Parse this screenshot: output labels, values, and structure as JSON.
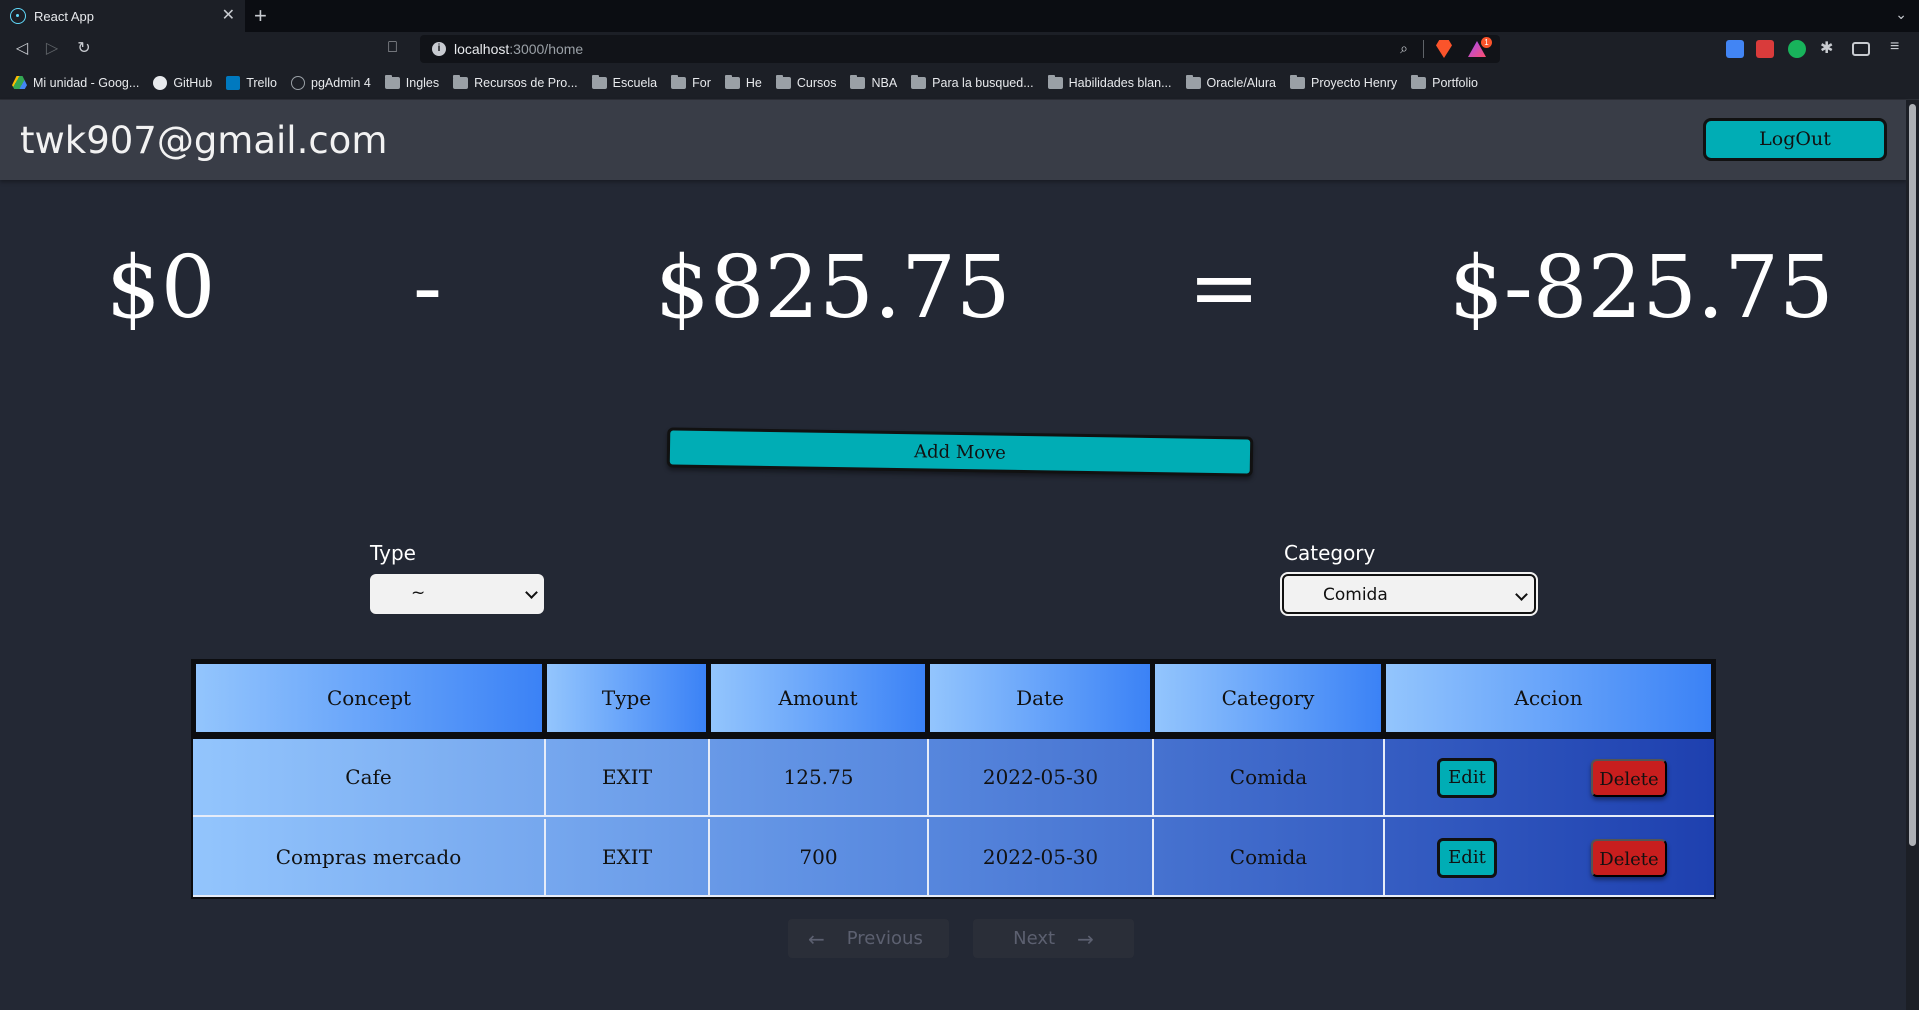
{
  "browser": {
    "tab_title": "React App",
    "url_host": "localhost",
    "url_path": ":3000/home",
    "rewards_badge": "1",
    "bookmarks": [
      {
        "label": "Mi unidad - Goog...",
        "icon": "drive-icon"
      },
      {
        "label": "GitHub",
        "icon": "github-icon"
      },
      {
        "label": "Trello",
        "icon": "trello-icon"
      },
      {
        "label": "pgAdmin 4",
        "icon": "pgadmin-icon"
      },
      {
        "label": "Ingles",
        "icon": "folder-icon"
      },
      {
        "label": "Recursos de Pro...",
        "icon": "folder-icon"
      },
      {
        "label": "Escuela",
        "icon": "folder-icon"
      },
      {
        "label": "For",
        "icon": "folder-icon"
      },
      {
        "label": "He",
        "icon": "folder-icon"
      },
      {
        "label": "Cursos",
        "icon": "folder-icon"
      },
      {
        "label": "NBA",
        "icon": "folder-icon"
      },
      {
        "label": "Para la busqued...",
        "icon": "folder-icon"
      },
      {
        "label": "Habilidades blan...",
        "icon": "folder-icon"
      },
      {
        "label": "Oracle/Alura",
        "icon": "folder-icon"
      },
      {
        "label": "Proyecto Henry",
        "icon": "folder-icon"
      },
      {
        "label": "Portfolio",
        "icon": "folder-icon"
      }
    ]
  },
  "header": {
    "user_email": "twk907@gmail.com",
    "logout_label": "LogOut"
  },
  "balance": {
    "income": "$0",
    "minus_sign": "-",
    "expense": "$825.75",
    "equals_sign": "=",
    "total": "$-825.75"
  },
  "actions": {
    "add_move_label": "Add Move"
  },
  "filters": {
    "type_label": "Type",
    "type_value": "~",
    "category_label": "Category",
    "category_value": "Comida"
  },
  "table": {
    "headers": [
      "Concept",
      "Type",
      "Amount",
      "Date",
      "Category",
      "Accion"
    ],
    "rows": [
      {
        "concept": "Cafe",
        "type": "EXIT",
        "amount": "125.75",
        "date": "2022-05-30",
        "category": "Comida"
      },
      {
        "concept": "Compras mercado",
        "type": "EXIT",
        "amount": "700",
        "date": "2022-05-30",
        "category": "Comida"
      }
    ],
    "edit_label": "Edit",
    "delete_label": "Delete"
  },
  "pagination": {
    "previous_label": "Previous",
    "next_label": "Next"
  },
  "colors": {
    "accent": "#00adb5",
    "delete": "#c81e1e",
    "background": "#232834",
    "header_bg": "#393d47"
  }
}
